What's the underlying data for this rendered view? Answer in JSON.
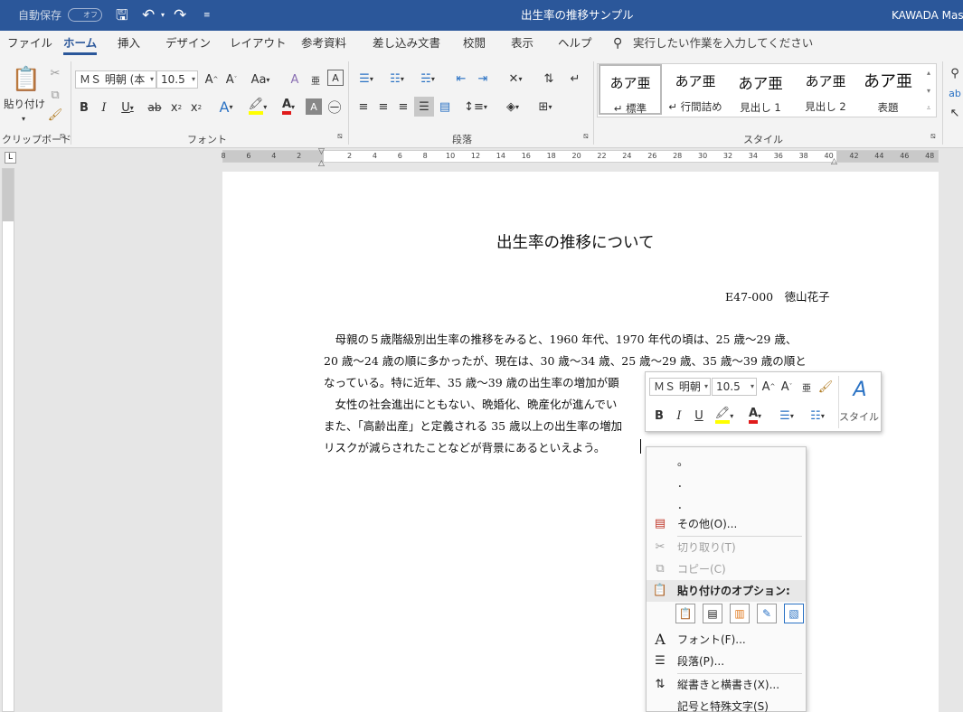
{
  "titlebar": {
    "autosave_label": "自動保存",
    "autosave_state": "オフ",
    "doc_title": "出生率の推移サンプル",
    "user": "KAWADA Mas"
  },
  "menu": [
    "ファイル",
    "ホーム",
    "挿入",
    "デザイン",
    "レイアウト",
    "参考資料",
    "差し込み文書",
    "校閲",
    "表示",
    "ヘルプ"
  ],
  "search_placeholder": "実行したい作業を入力してください",
  "ribbon": {
    "clipboard": {
      "paste_label": "貼り付け",
      "group_label": "クリップボード"
    },
    "font": {
      "font_name": "ＭＳ 明朝 (本",
      "font_size": "10.5",
      "group_label": "フォント"
    },
    "paragraph": {
      "group_label": "段落"
    },
    "styles": {
      "group_label": "スタイル",
      "items": [
        {
          "preview": "あア亜",
          "name": "↵ 標準"
        },
        {
          "preview": "あア亜",
          "name": "↵ 行間詰め"
        },
        {
          "preview": "あア亜",
          "name": "見出し 1"
        },
        {
          "preview": "あア亜",
          "name": "見出し 2"
        },
        {
          "preview": "あア亜",
          "name": "表題"
        }
      ]
    }
  },
  "ruler_labels": [
    "8",
    "6",
    "4",
    "2",
    "",
    "2",
    "4",
    "6",
    "8",
    "10",
    "12",
    "14",
    "16",
    "18",
    "20",
    "22",
    "24",
    "26",
    "28",
    "30",
    "32",
    "34",
    "36",
    "38",
    "40",
    "42",
    "44",
    "46",
    "48"
  ],
  "document": {
    "title": "出生率の推移について",
    "author": "E47-000　徳山花子",
    "lines": [
      "　母親の５歳階級別出生率の推移をみると、1960 年代、1970 年代の頃は、25 歳～29 歳、",
      "20 歳～24 歳の順に多かったが、現在は、30 歳～34 歳、25 歳～29 歳、35 歳～39 歳の順と",
      "なっている。特に近年、35 歳～39 歳の出生率の増加が顕",
      "　女性の社会進出にともない、晩婚化、晩産化が進んでい",
      "また、「高齢出産」と定義される 35 歳以上の出生率の増加",
      "リスクが減らされたことなどが背景にあるといえよう。"
    ]
  },
  "mini_toolbar": {
    "font_name": "ＭＳ 明朝",
    "font_size": "10.5",
    "style_label": "スタイル"
  },
  "context_menu": {
    "symbols": [
      "。",
      "．",
      "．"
    ],
    "more": "その他(O)...",
    "cut": "切り取り(T)",
    "copy": "コピー(C)",
    "paste_options": "貼り付けのオプション:",
    "font": "フォント(F)...",
    "paragraph": "段落(P)...",
    "direction": "縦書きと横書き(X)...",
    "special_chars": "記号と特殊文字(S)"
  },
  "colors": {
    "accent": "#2b579a",
    "highlight": "#ffff00",
    "font_color": "#e01b1b"
  }
}
